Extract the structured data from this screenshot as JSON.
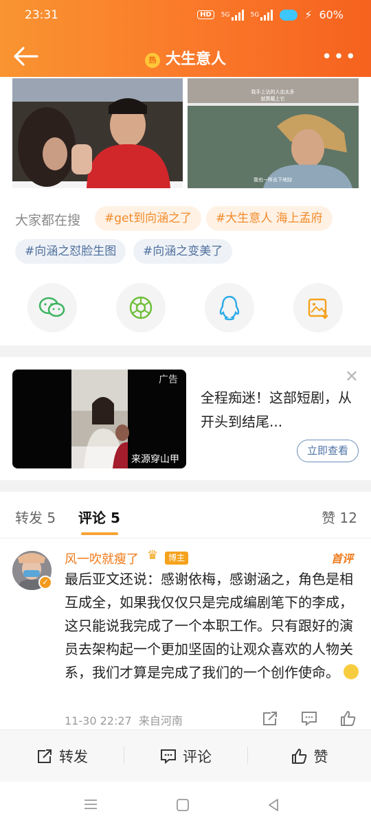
{
  "status_bar": {
    "time": "23:31",
    "battery": "60%",
    "network1": "5G",
    "network2": "5G",
    "hd": "HD"
  },
  "nav": {
    "title": "大生意人",
    "hot_badge": "热"
  },
  "images": [
    {
      "caption": ""
    },
    {
      "caption_top": "我手上沾的人血太多",
      "caption_mid": "就算戴上它",
      "caption_bottom": "我也一样去下地狱"
    }
  ],
  "search": {
    "label": "大家都在搜",
    "tags": [
      "#get到向涵之了",
      "#大生意人 海上孟府",
      "#向涵之怼脸生图",
      "#向涵之变美了"
    ]
  },
  "ad": {
    "badge": "广告",
    "source": "来源穿山甲",
    "text": "全程痴迷！这部短剧，从开头到结尾...",
    "button": "立即查看"
  },
  "tabs": {
    "repost": "转发 5",
    "comment": "评论 5",
    "like": "赞 12"
  },
  "comment": {
    "username": "风一吹就瘦了",
    "badge": "博主",
    "first_badge": "首评",
    "text": "最后亚文还说：感谢依梅，感谢涵之，角色是相互成全，如果我仅仅只是完成编剧笔下的李成，这只能说我完成了一个本职工作。只有跟好的演员去架构起一个更加坚固的让观众喜欢的人物关系，我们才算是完成了我们的一个创作使命。",
    "time": "11-30 22:27",
    "source": "来自河南"
  },
  "bottom_bar": {
    "repost": "转发",
    "comment": "评论",
    "like": "赞"
  },
  "colors": {
    "accent": "#f7801f",
    "link_blue": "#4f6f9c",
    "tag_orange": "#f08a2a"
  }
}
